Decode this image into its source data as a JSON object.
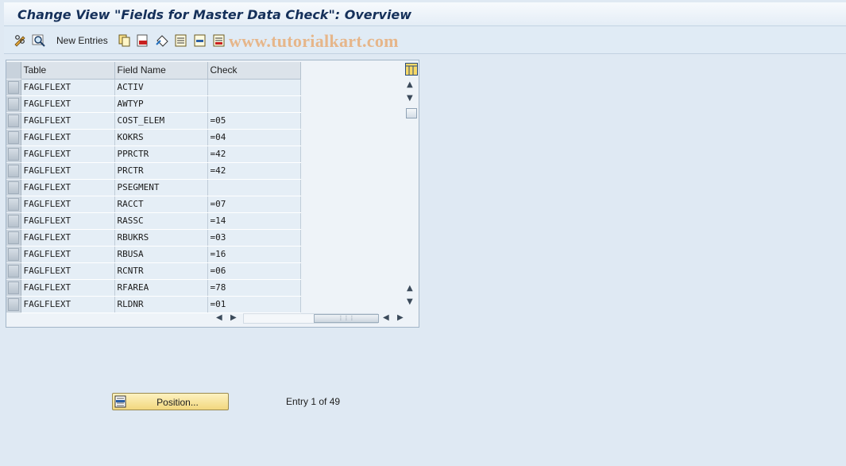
{
  "title": "Change View \"Fields for Master Data Check\": Overview",
  "toolbar": {
    "new_entries_label": "New Entries",
    "watermark": "www.tutorialkart.com",
    "icons": [
      "glasses-pen-icon",
      "find-icon",
      "copy-icon",
      "delete-icon",
      "undo-icon",
      "select-all-icon",
      "select-block-icon",
      "deselect-all-icon"
    ]
  },
  "table": {
    "columns": [
      "Table",
      "Field Name",
      "Check"
    ],
    "rows": [
      {
        "table": "FAGLFLEXT",
        "field": "ACTIV",
        "check": ""
      },
      {
        "table": "FAGLFLEXT",
        "field": "AWTYP",
        "check": ""
      },
      {
        "table": "FAGLFLEXT",
        "field": "COST_ELEM",
        "check": "=05"
      },
      {
        "table": "FAGLFLEXT",
        "field": "KOKRS",
        "check": "=04"
      },
      {
        "table": "FAGLFLEXT",
        "field": "PPRCTR",
        "check": "=42"
      },
      {
        "table": "FAGLFLEXT",
        "field": "PRCTR",
        "check": "=42"
      },
      {
        "table": "FAGLFLEXT",
        "field": "PSEGMENT",
        "check": ""
      },
      {
        "table": "FAGLFLEXT",
        "field": "RACCT",
        "check": "=07"
      },
      {
        "table": "FAGLFLEXT",
        "field": "RASSC",
        "check": "=14"
      },
      {
        "table": "FAGLFLEXT",
        "field": "RBUKRS",
        "check": "=03"
      },
      {
        "table": "FAGLFLEXT",
        "field": "RBUSA",
        "check": "=16"
      },
      {
        "table": "FAGLFLEXT",
        "field": "RCNTR",
        "check": "=06"
      },
      {
        "table": "FAGLFLEXT",
        "field": "RFAREA",
        "check": "=78"
      },
      {
        "table": "FAGLFLEXT",
        "field": "RLDNR",
        "check": "=01"
      }
    ]
  },
  "footer": {
    "position_button_label": "Position...",
    "entry_info": "Entry 1 of 49"
  },
  "colors": {
    "background": "#dfe9f3",
    "title_text": "#15305a",
    "position_button": "#f2d77e",
    "watermark": "#e6b68a"
  }
}
